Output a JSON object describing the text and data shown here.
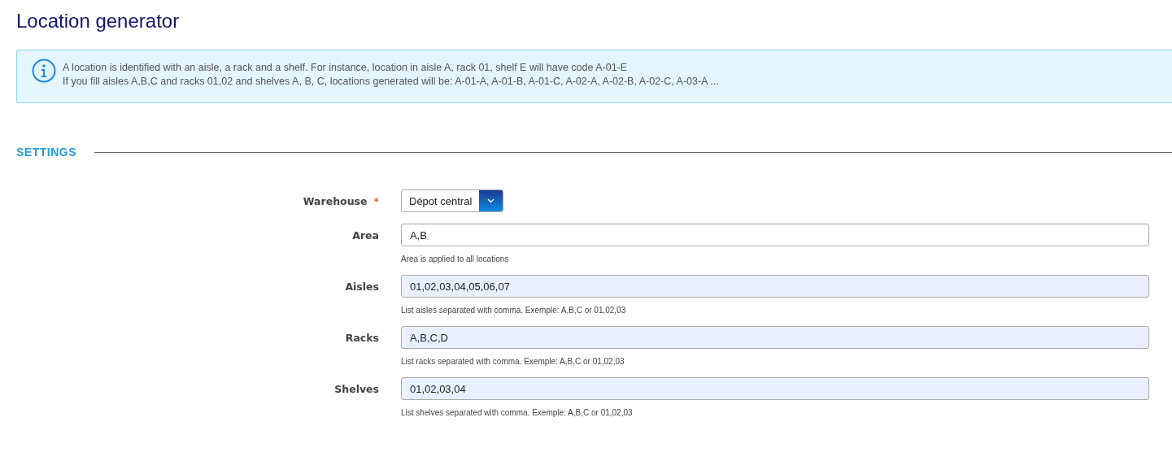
{
  "title": "Location generator",
  "info": {
    "lines": [
      "A location is identified with an aisle, a rack and a shelf. For instance, location in aisle A, rack 01, shelf E will have code A-01-E",
      "If you fill aisles A,B,C and racks 01,02 and shelves A, B, C, locations generated will be: A-01-A, A-01-B, A-01-C, A-02-A, A-02-B, A-02-C, A-03-A ..."
    ]
  },
  "section": "SETTINGS",
  "fields": [
    {
      "kind": "select",
      "label": "Warehouse",
      "required_mark": "*",
      "value": "Dépot central"
    },
    {
      "kind": "text",
      "label": "Area",
      "value": "A,B",
      "autofilled": false,
      "help": "Area is applied to all locations"
    },
    {
      "kind": "text",
      "label": "Aisles",
      "value": "01,02,03,04,05,06,07",
      "autofilled": true,
      "help": "List aisles separated with comma. Exemple: A,B,C or 01,02,03"
    },
    {
      "kind": "text",
      "label": "Racks",
      "value": "A,B,C,D",
      "autofilled": true,
      "help": "List racks separated with comma. Exemple: A,B,C or 01,02,03"
    },
    {
      "kind": "text",
      "label": "Shelves",
      "value": "01,02,03,04",
      "autofilled": true,
      "help": "List shelves separated with comma. Exemple: A,B,C or 01,02,03"
    }
  ]
}
